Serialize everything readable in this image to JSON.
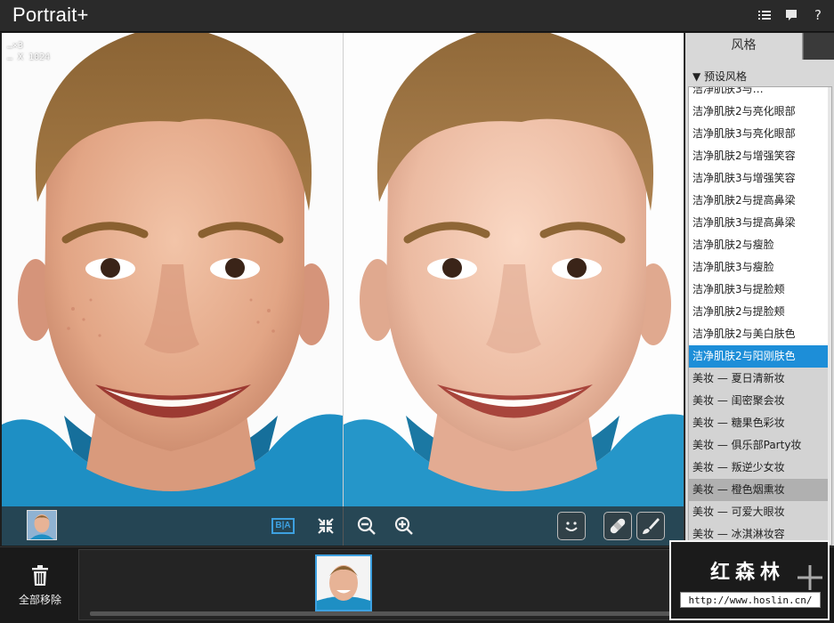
{
  "app": {
    "title": "Portrait+"
  },
  "titlebar": {
    "icons": [
      "list-icon",
      "chat-icon",
      "help-icon"
    ],
    "help_label": "?"
  },
  "preview": {
    "info_line1": "…×3",
    "info_line2": "… X 1024",
    "toolbar": {
      "icons": [
        "thumbnail",
        "before-after-icon",
        "fit-screen-icon",
        "zoom-out-icon",
        "zoom-in-icon",
        "smile-icon",
        "bandage-icon",
        "brush-icon"
      ],
      "ba_label": "B|A"
    }
  },
  "panel": {
    "tab_label": "风格",
    "section_label": "▼ 预设风格",
    "items": [
      "洁净肌肤3与…",
      "洁净肌肤2与亮化眼部",
      "洁净肌肤3与亮化眼部",
      "洁净肌肤2与增强笑容",
      "洁净肌肤3与增强笑容",
      "洁净肌肤2与提高鼻梁",
      "洁净肌肤3与提高鼻梁",
      "洁净肌肤2与瘦脸",
      "洁净肌肤3与瘦脸",
      "洁净肌肤3与提脸颊",
      "洁净肌肤2与提脸颊",
      "洁净肌肤2与美白肤色",
      "洁净肌肤2与阳刚肤色",
      "美妆 — 夏日清新妆",
      "美妆 — 闺密聚会妆",
      "美妆 — 糖果色彩妆",
      "美妆 — 俱乐部Party妆",
      "美妆 — 叛逆少女妆",
      "美妆 — 橙色烟熏妆",
      "美妆 — 可爱大眼妆",
      "美妆 — 冰淇淋妆容"
    ],
    "selected_index": 12,
    "hover_index": 18,
    "selected_color": "#1d8ed8"
  },
  "bottom": {
    "remove_all_label": "全部移除"
  },
  "watermark": {
    "text": "红森林",
    "url": "http://www.hoslin.cn/"
  }
}
